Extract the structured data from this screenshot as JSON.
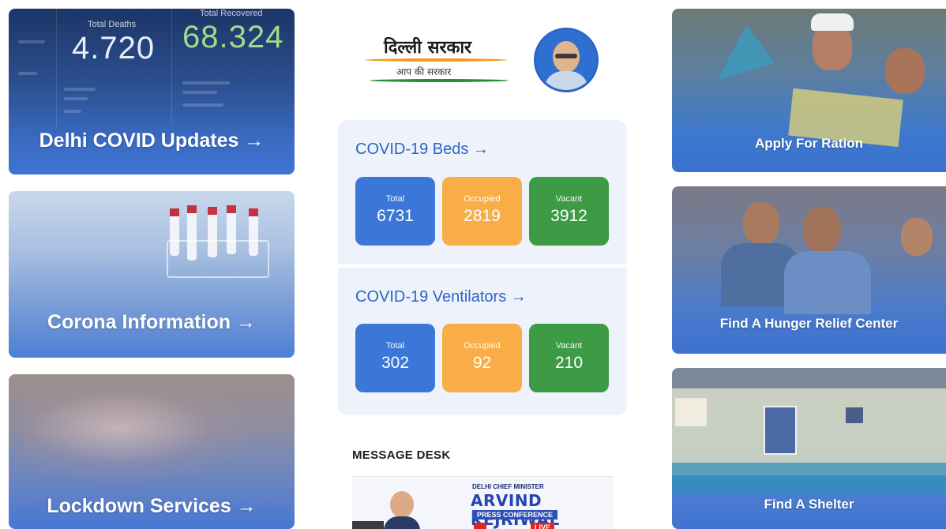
{
  "left_cards": {
    "covid": {
      "label": "Delhi COVID Updates →",
      "total_deaths_label": "Total Deaths",
      "total_deaths": "4.720",
      "total_recovered_label": "Total Recovered",
      "total_recovered": "68.324"
    },
    "corona": {
      "label": "Corona Information →"
    },
    "lockdown": {
      "label": "Lockdown Services →"
    }
  },
  "logo": {
    "title": "दिल्ली सरकार",
    "tagline": "आप की सरकार"
  },
  "beds": {
    "title": "COVID-19 Beds →",
    "tiles": [
      {
        "label": "Total",
        "value": "6731"
      },
      {
        "label": "Occupied",
        "value": "2819"
      },
      {
        "label": "Vacant",
        "value": "3912"
      }
    ]
  },
  "ventilators": {
    "title": "COVID-19 Ventilators →",
    "tiles": [
      {
        "label": "Total",
        "value": "302"
      },
      {
        "label": "Occupied",
        "value": "92"
      },
      {
        "label": "Vacant",
        "value": "210"
      }
    ]
  },
  "message_desk": {
    "title": "MESSAGE DESK",
    "banner": {
      "subtitle": "DELHI CHIEF MINISTER",
      "name": "ARVIND KEJRIWAL",
      "event": "PRESS CONFERENCE",
      "live": "LIVE"
    }
  },
  "right_cards": {
    "ration": {
      "label": "Apply For Ration"
    },
    "hunger": {
      "label": "Find A Hunger Relief Center"
    },
    "shelter": {
      "label": "Find A Shelter"
    }
  },
  "colors": {
    "primary_blue": "#3b77d8",
    "orange": "#f9ad47",
    "green": "#3d9a45",
    "panel_bg": "#eef3fb",
    "title_blue": "#2c63c6",
    "recovered_green": "#9fdc8a"
  }
}
